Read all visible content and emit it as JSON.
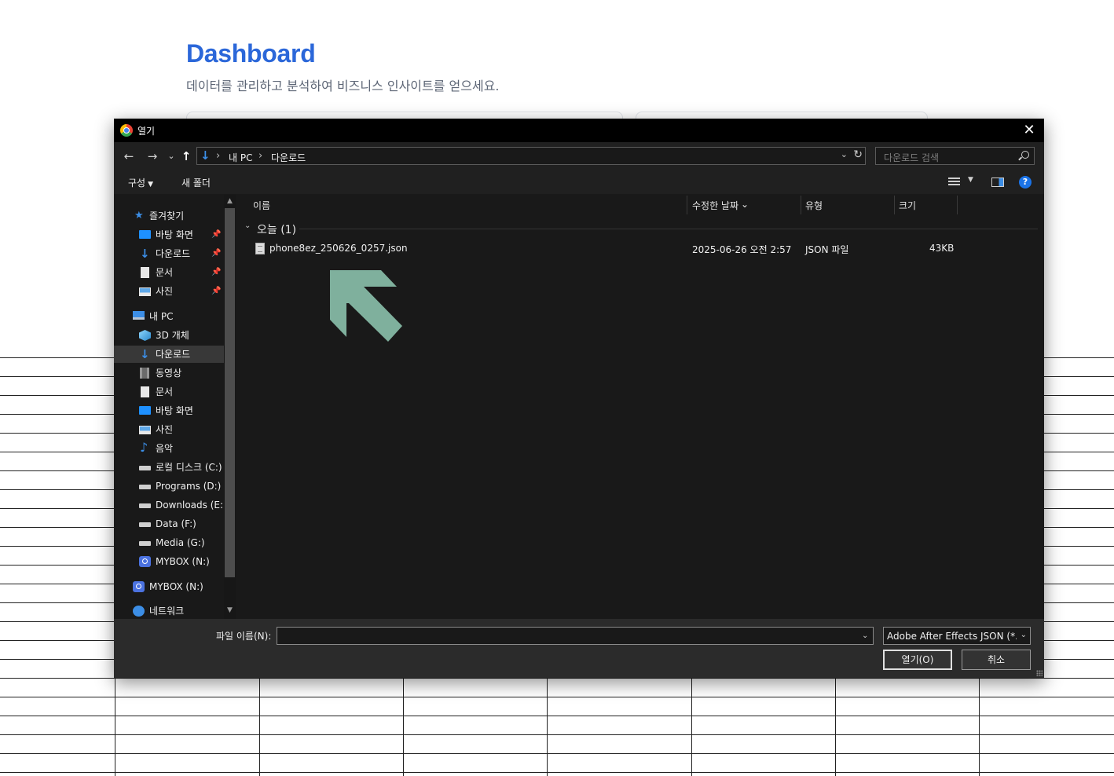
{
  "page": {
    "title": "Dashboard",
    "subtitle": "데이터를 관리하고 분석하여 비즈니스 인사이트를 얻으세요."
  },
  "dialog": {
    "title": "열기",
    "close_label": "✕",
    "nav": {
      "back_icon": "←",
      "forward_icon": "→",
      "recent_icon": "⌄",
      "up_icon": "↑",
      "breadcrumb": [
        "내 PC",
        "다운로드"
      ],
      "breadcrumb_sep": "›",
      "search_placeholder": "다운로드 검색"
    },
    "toolbar": {
      "organize_label": "구성",
      "new_folder_label": "새 폴더",
      "help_label": "?"
    },
    "sidebar": {
      "items": [
        {
          "label": "즐겨찾기",
          "icon": "star-icon"
        },
        {
          "label": "바탕 화면",
          "icon": "desktop-icon",
          "pinned": true
        },
        {
          "label": "다운로드",
          "icon": "download-icon",
          "pinned": true
        },
        {
          "label": "문서",
          "icon": "document-icon",
          "pinned": true
        },
        {
          "label": "사진",
          "icon": "pictures-icon",
          "pinned": true
        },
        {
          "label": "내 PC",
          "icon": "pc-icon"
        },
        {
          "label": "3D 개체",
          "icon": "3d-objects-icon"
        },
        {
          "label": "다운로드",
          "icon": "download-icon",
          "selected": true
        },
        {
          "label": "동영상",
          "icon": "video-icon"
        },
        {
          "label": "문서",
          "icon": "document-icon"
        },
        {
          "label": "바탕 화면",
          "icon": "desktop-icon"
        },
        {
          "label": "사진",
          "icon": "pictures-icon"
        },
        {
          "label": "음악",
          "icon": "music-icon"
        },
        {
          "label": "로컬 디스크 (C:)",
          "icon": "drive-icon"
        },
        {
          "label": "Programs (D:)",
          "icon": "drive-icon"
        },
        {
          "label": "Downloads (E:)",
          "icon": "drive-icon"
        },
        {
          "label": "Data (F:)",
          "icon": "drive-icon"
        },
        {
          "label": "Media (G:)",
          "icon": "drive-icon"
        },
        {
          "label": "MYBOX (N:)",
          "icon": "mybox-icon"
        },
        {
          "label": "MYBOX (N:)",
          "icon": "mybox-icon"
        },
        {
          "label": "네트워크",
          "icon": "network-icon"
        }
      ],
      "pin_icon": "📌"
    },
    "columns": {
      "name": "이름",
      "modified": "수정한 날짜",
      "type": "유형",
      "size": "크기"
    },
    "group": {
      "label": "오늘 (1)"
    },
    "files": [
      {
        "name": "phone8ez_250626_0257.json",
        "modified": "2025-06-26 오전 2:57",
        "type": "JSON 파일",
        "size": "43KB"
      }
    ],
    "bottom": {
      "filename_label": "파일 이름(N):",
      "filename_value": "",
      "filter_value": "Adobe After Effects JSON (*.json)",
      "open_label": "열기(O)",
      "cancel_label": "취소"
    }
  },
  "colors": {
    "accent": "#2b67d9",
    "dialog_bg": "#191919",
    "arrow": "#7fb09d"
  }
}
